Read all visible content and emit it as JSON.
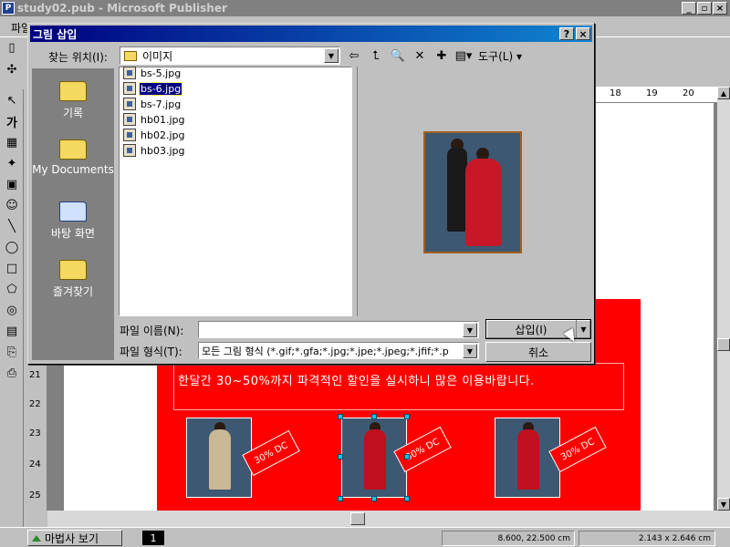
{
  "app": {
    "title": "study02.pub - Microsoft Publisher",
    "icon_glyph": "P",
    "menu_first": "파일",
    "win_minimize": "_",
    "win_restore": "▫",
    "win_close": "×"
  },
  "dialog": {
    "title": "그림 삽입",
    "help_btn": "?",
    "close_btn": "×",
    "look_in_label": "찾는 위치(I):",
    "look_in_value": "이미지",
    "tools_label": "도구(L) ▾",
    "places": [
      {
        "label": "기록",
        "icon": "history-icon"
      },
      {
        "label": "My Documents",
        "icon": "my-documents-icon"
      },
      {
        "label": "바탕 화면",
        "icon": "desktop-icon"
      },
      {
        "label": "즐겨찾기",
        "icon": "favorites-icon"
      }
    ],
    "files": [
      {
        "name": "bs-5.jpg",
        "selected": false
      },
      {
        "name": "bs-6.jpg",
        "selected": true
      },
      {
        "name": "bs-7.jpg",
        "selected": false
      },
      {
        "name": "hb01.jpg",
        "selected": false
      },
      {
        "name": "hb02.jpg",
        "selected": false
      },
      {
        "name": "hb03.jpg",
        "selected": false
      }
    ],
    "file_name_label": "파일 이름(N):",
    "file_name_value": "",
    "file_type_label": "파일 형식(T):",
    "file_type_value": "모든 그림 형식 (*.gif;*.gfa;*.jpg;*.jpe;*.jpeg;*.jfif;*.p",
    "insert_button": "삽입(I)",
    "cancel_button": "취소"
  },
  "document": {
    "promo_text": "한달간 30~50%까지 파격적인 할인을 실시하니 많은 이용바랍니다.",
    "tag_text": "30% DC",
    "ruler_h": [
      "18",
      "19",
      "20"
    ],
    "ruler_v": [
      "21",
      "22",
      "23",
      "24",
      "25"
    ]
  },
  "status": {
    "wizard_label": "마법사 보기",
    "page_number": "1",
    "position": "8.600, 22.500 cm",
    "size": "2.143 x 2.646 cm"
  },
  "colors": {
    "title_active": "#000080",
    "red_panel": "#ff0000",
    "places_bg": "#808080",
    "selection": "#000080"
  }
}
